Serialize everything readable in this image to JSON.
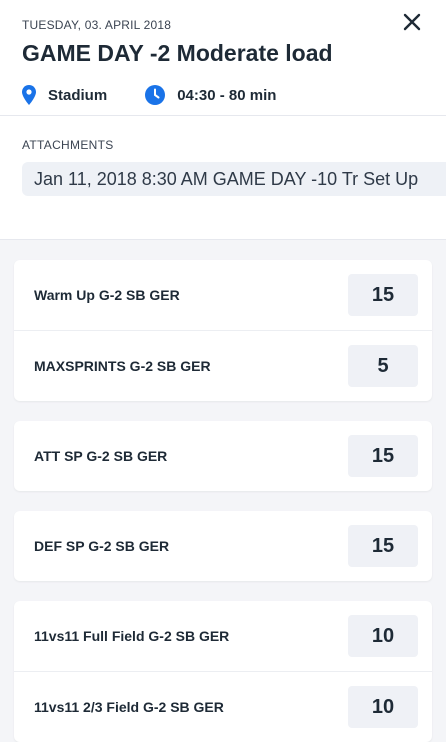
{
  "header": {
    "date": "TUESDAY, 03. APRIL 2018",
    "title": "GAME DAY -2 Moderate load",
    "location": "Stadium",
    "time": "04:30 - 80 min"
  },
  "attachments": {
    "label": "ATTACHMENTS",
    "items": [
      "Jan 11, 2018 8:30 AM GAME DAY -10 Tr Set Up"
    ]
  },
  "colors": {
    "accent": "#1a73e8"
  },
  "groups": [
    {
      "rows": [
        {
          "label": "Warm Up G-2 SB GER",
          "value": "15"
        },
        {
          "label": "MAXSPRINTS G-2 SB GER",
          "value": "5"
        }
      ]
    },
    {
      "rows": [
        {
          "label": "ATT SP G-2 SB GER",
          "value": "15"
        }
      ]
    },
    {
      "rows": [
        {
          "label": "DEF SP G-2 SB GER",
          "value": "15"
        }
      ]
    },
    {
      "rows": [
        {
          "label": "11vs11 Full Field G-2 SB GER",
          "value": "10"
        },
        {
          "label": "11vs11 2/3 Field G-2 SB GER",
          "value": "10"
        }
      ]
    }
  ]
}
